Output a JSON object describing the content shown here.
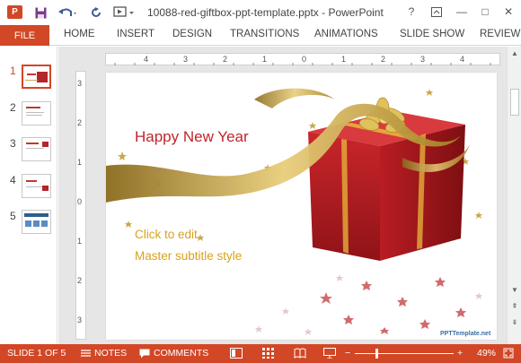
{
  "window": {
    "title": "10088-red-giftbox-ppt-template.pptx - PowerPoint",
    "app_icon_text": "P",
    "help": "?",
    "controls": {
      "minimize": "—",
      "restore": "□",
      "close": "✕"
    }
  },
  "ribbon": {
    "file": "FILE",
    "tabs": [
      "HOME",
      "INSERT",
      "DESIGN",
      "TRANSITIONS",
      "ANIMATIONS",
      "SLIDE SHOW",
      "REVIEW"
    ]
  },
  "thumbnails": {
    "items": [
      {
        "number": "1",
        "active": true
      },
      {
        "number": "2",
        "active": false
      },
      {
        "number": "3",
        "active": false
      },
      {
        "number": "4",
        "active": false
      },
      {
        "number": "5",
        "active": false
      }
    ]
  },
  "ruler": {
    "horizontal": [
      "4",
      "3",
      "2",
      "1",
      "0",
      "1",
      "2",
      "3",
      "4"
    ],
    "vertical": [
      "3",
      "2",
      "1",
      "0",
      "1",
      "2",
      "3"
    ]
  },
  "slide": {
    "title": "Happy New Year",
    "subtitle_line1": "Click to edit",
    "subtitle_line2": "Master subtitle style",
    "logo": "PPTTemplate.net"
  },
  "statusbar": {
    "slide_info": "SLIDE 1 OF 5",
    "notes": "NOTES",
    "comments": "COMMENTS",
    "zoom_level": "49%",
    "zoom_value": 49
  },
  "colors": {
    "accent": "#d24726",
    "title_red": "#c0252a",
    "subtitle_gold": "#d9a21c"
  }
}
